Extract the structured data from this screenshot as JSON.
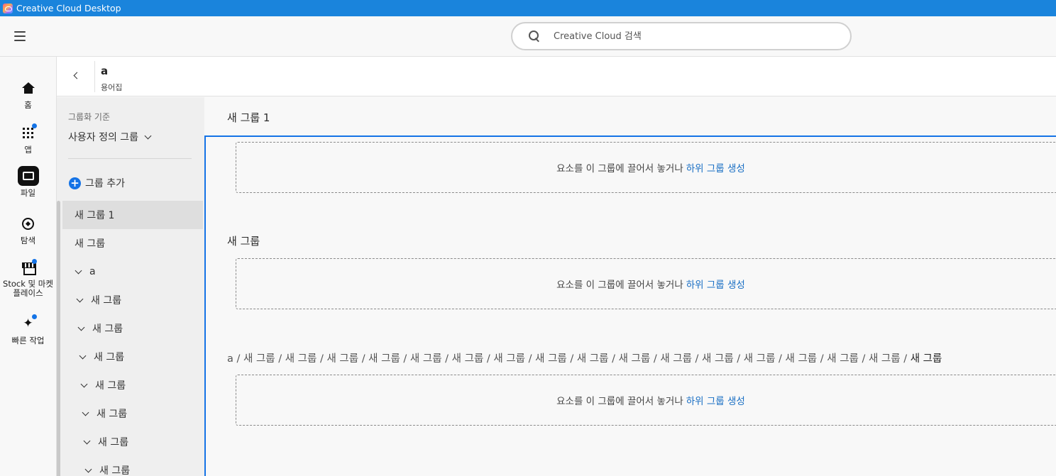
{
  "window": {
    "title": "Creative Cloud Desktop"
  },
  "search": {
    "placeholder": "Creative Cloud 검색"
  },
  "rail": {
    "home": "홈",
    "apps": "앱",
    "files": "파일",
    "discover": "탐색",
    "stock": "Stock 및 마켓플레이스",
    "quick": "빠른 작업"
  },
  "header": {
    "title": "a",
    "subtitle": "용어집"
  },
  "groupPanel": {
    "label": "그룹화 기준",
    "selected": "사용자 정의 그룹",
    "addGroup": "그룹 추가",
    "items": [
      {
        "label": "새 그룹 1"
      },
      {
        "label": "새 그룹"
      },
      {
        "label": "a"
      },
      {
        "label": "새 그룹"
      },
      {
        "label": "새 그룹"
      },
      {
        "label": "새 그룹"
      },
      {
        "label": "새 그룹"
      },
      {
        "label": "새 그룹"
      },
      {
        "label": "새 그룹"
      },
      {
        "label": "새 그룹"
      }
    ]
  },
  "content": {
    "section1": "새 그룹 1",
    "section2": "새 그룹",
    "pathPrefix": "a / 새 그룹 / 새 그룹 / 새 그룹 / 새 그룹 / 새 그룹 / 새 그룹 / 새 그룹 / 새 그룹 / 새 그룹 / 새 그룹 / 새 그룹 / 새 그룹 / 새 그룹 / 새 그룹 / 새 그룹 / 새 그룹 / ",
    "pathCurrent": "새 그룹",
    "dropText": "요소를 이 그룹에 끌어서 놓거나",
    "dropLink": "하위 그룹 생성"
  },
  "colors": {
    "titlebar": "#1a84dc",
    "accent": "#1473e6",
    "link": "#1a6fc4"
  }
}
